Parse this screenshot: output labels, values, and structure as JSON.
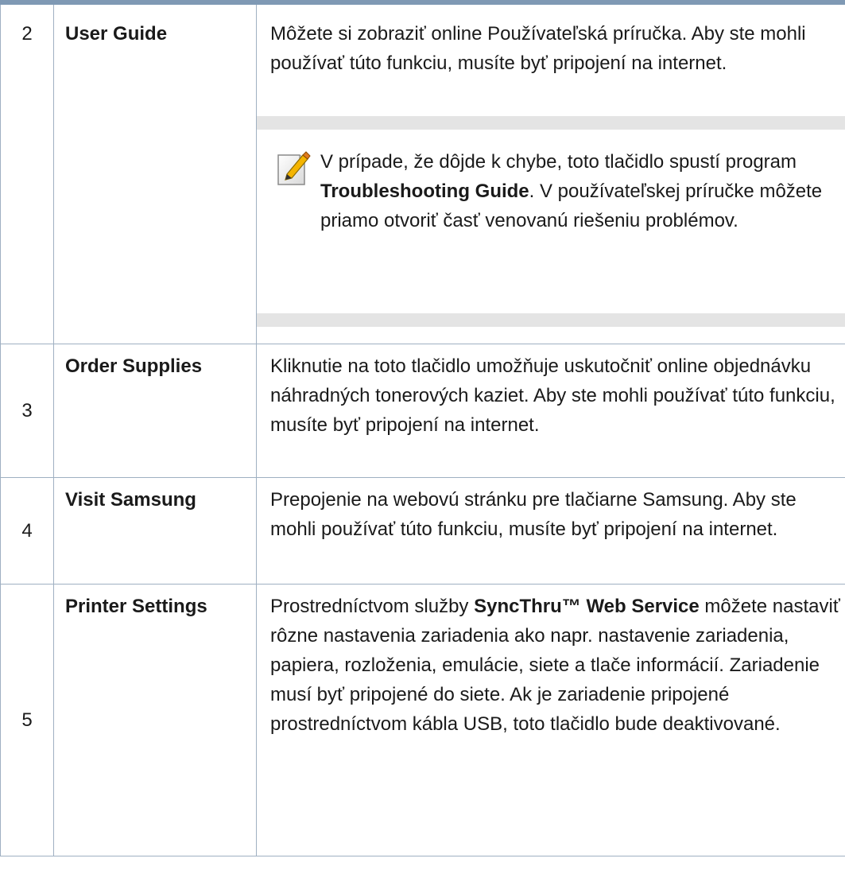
{
  "rows": [
    {
      "number": "2",
      "name": "User Guide",
      "description": "Môžete si zobraziť online Používateľská príručka. Aby ste mohli používať túto funkciu, musíte byť pripojení na internet.",
      "note": {
        "icon": "note-pencil-icon",
        "text_before": "V prípade, že dôjde k chybe, toto tlačidlo spustí program ",
        "bold": "Troubleshooting Guide",
        "text_after": ". V používateľskej príručke môžete priamo otvoriť časť venovanú riešeniu problémov."
      }
    },
    {
      "number": "3",
      "name": "Order Supplies",
      "description": "Kliknutie na toto tlačidlo umožňuje uskutočniť online objednávku náhradných tonerových kaziet. Aby ste mohli používať túto funkciu, musíte byť pripojení na internet."
    },
    {
      "number": "4",
      "name": "Visit Samsung",
      "description": "Prepojenie na webovú stránku pre tlačiarne Samsung. Aby ste mohli používať túto funkciu, musíte byť pripojení na internet."
    },
    {
      "number": "5",
      "name": "Printer Settings",
      "description_before": "Prostredníctvom služby ",
      "description_bold": "SyncThru™ Web Service",
      "description_after": " môžete nastaviť rôzne nastavenia zariadenia ako napr. nastavenie zariadenia, papiera, rozloženia, emulácie, siete a tlače informácií. Zariadenie musí byť pripojené do siete. Ak je zariadenie pripojené prostredníctvom kábla USB, toto tlačidlo bude deaktivované."
    }
  ],
  "colors": {
    "top_rule": "#7f99b4",
    "table_border": "#9fb0c2",
    "note_band": "#e4e4e4"
  }
}
